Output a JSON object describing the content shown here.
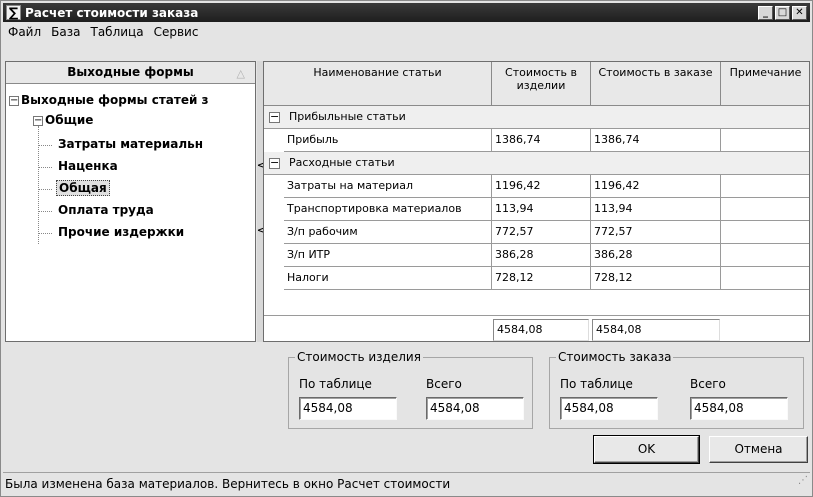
{
  "window": {
    "title": "Расчет стоимости заказа",
    "app_icon": "sigma-icon",
    "min_glyph": "_",
    "max_glyph": "□",
    "close_glyph": "✕"
  },
  "menu": [
    "Файл",
    "База",
    "Таблица",
    "Сервис"
  ],
  "tree": {
    "header": "Выходные формы",
    "sort_glyph": "△",
    "root": "Выходные формы статей з",
    "group": "Общие",
    "items": [
      "Затраты материальн",
      "Наценка",
      "Общая",
      "Оплата труда",
      "Прочие издержки"
    ],
    "selected": "Общая",
    "expander_minus": "−"
  },
  "splitter": {
    "arrow": "<"
  },
  "grid": {
    "columns": [
      "Наименование статьи",
      "Стоимость в изделии",
      "Стоимость в заказе",
      "Примечание"
    ],
    "groups": [
      {
        "label": "Прибыльные статьи",
        "rows": [
          {
            "name": "Прибыль",
            "item_cost": "1386,74",
            "order_cost": "1386,74",
            "note": ""
          }
        ]
      },
      {
        "label": "Расходные статьи",
        "rows": [
          {
            "name": "Затраты на материал",
            "item_cost": "1196,42",
            "order_cost": "1196,42",
            "note": ""
          },
          {
            "name": "Транспортировка материалов",
            "item_cost": "113,94",
            "order_cost": "113,94",
            "note": ""
          },
          {
            "name": "З/п рабочим",
            "item_cost": "772,57",
            "order_cost": "772,57",
            "note": ""
          },
          {
            "name": "З/п ИТР",
            "item_cost": "386,28",
            "order_cost": "386,28",
            "note": ""
          },
          {
            "name": "Налоги",
            "item_cost": "728,12",
            "order_cost": "728,12",
            "note": ""
          }
        ]
      }
    ],
    "totals": {
      "item_cost": "4584,08",
      "order_cost": "4584,08"
    }
  },
  "item_cost_box": {
    "legend": "Стоимость изделия",
    "by_table_label": "По таблице",
    "total_label": "Всего",
    "by_table_value": "4584,08",
    "total_value": "4584,08"
  },
  "order_cost_box": {
    "legend": "Стоимость заказа",
    "by_table_label": "По таблице",
    "total_label": "Всего",
    "by_table_value": "4584,08",
    "total_value": "4584,08"
  },
  "buttons": {
    "ok": "OK",
    "cancel": "Отмена"
  },
  "status": "Была изменена база материалов. Вернитесь в окно Расчет стоимости"
}
